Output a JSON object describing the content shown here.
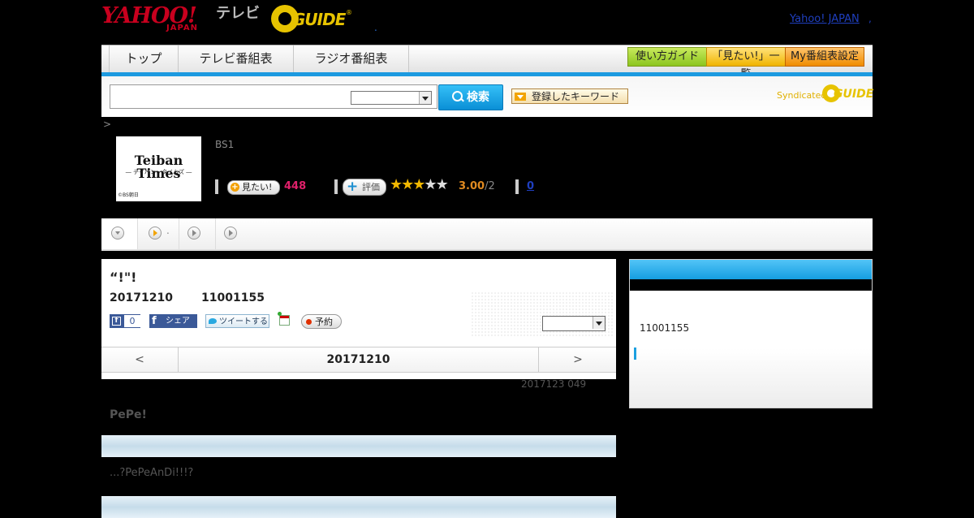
{
  "header": {
    "yahoo_logo": "YAHOO!",
    "yahoo_logo_sub": "JAPAN",
    "tv_label": "テレビ",
    "gguide_logo": "GUIDE",
    "gguide_mark": "®",
    "dot": ".",
    "yahoo_japan_link": "Yahoo! JAPAN",
    "dot2": ","
  },
  "nav": {
    "tabs": [
      {
        "label": "トップ"
      },
      {
        "label": "テレビ番組表"
      },
      {
        "label": "ラジオ番組表"
      }
    ],
    "buttons": {
      "guide": "使い方ガイド",
      "mitai_list": "「見たい!」一覧",
      "my_bangumi": "My番組表設定"
    },
    "colors": {
      "accent_blue": "#1c9ae0",
      "button_green": "#8cc51e",
      "button_yellow": "#f0b400",
      "button_orange": "#f08c00"
    }
  },
  "search": {
    "input_value": "",
    "select_value": "",
    "button_label": "検索",
    "keyword_button": "登録したキーワード",
    "syndicated_label": "Syndicated",
    "syndicated_logo": "GUIDE"
  },
  "breadcrumb": ">",
  "program": {
    "thumbnail_title": "Teiban Times",
    "thumbnail_subtitle": "― テイバン・タイムズ ―",
    "thumbnail_credit": "©BS朝日",
    "channel": "BS1",
    "mitai_label": "見たい!",
    "mitai_count": "448",
    "hyoka_label": "評価",
    "rating_stars_filled": 3,
    "rating_stars_total": 5,
    "rating_value": "3.00",
    "rating_count": "/2",
    "comment_count": "0",
    "subtab_dot": "."
  },
  "main": {
    "title": "“!\"!",
    "date": "20171210",
    "time": "11001155",
    "like_count": "0",
    "share_label": "シェア",
    "tweet_label": "ツイートする",
    "reserve_label": "予約",
    "select_value": "",
    "day_prev": "<",
    "day_current": "20171210",
    "day_next": ">"
  },
  "updated": "2017123  049",
  "detail": {
    "title": "PePe!",
    "description": "...?PePeAnDi!!!?"
  },
  "side": {
    "time": "11001155"
  }
}
